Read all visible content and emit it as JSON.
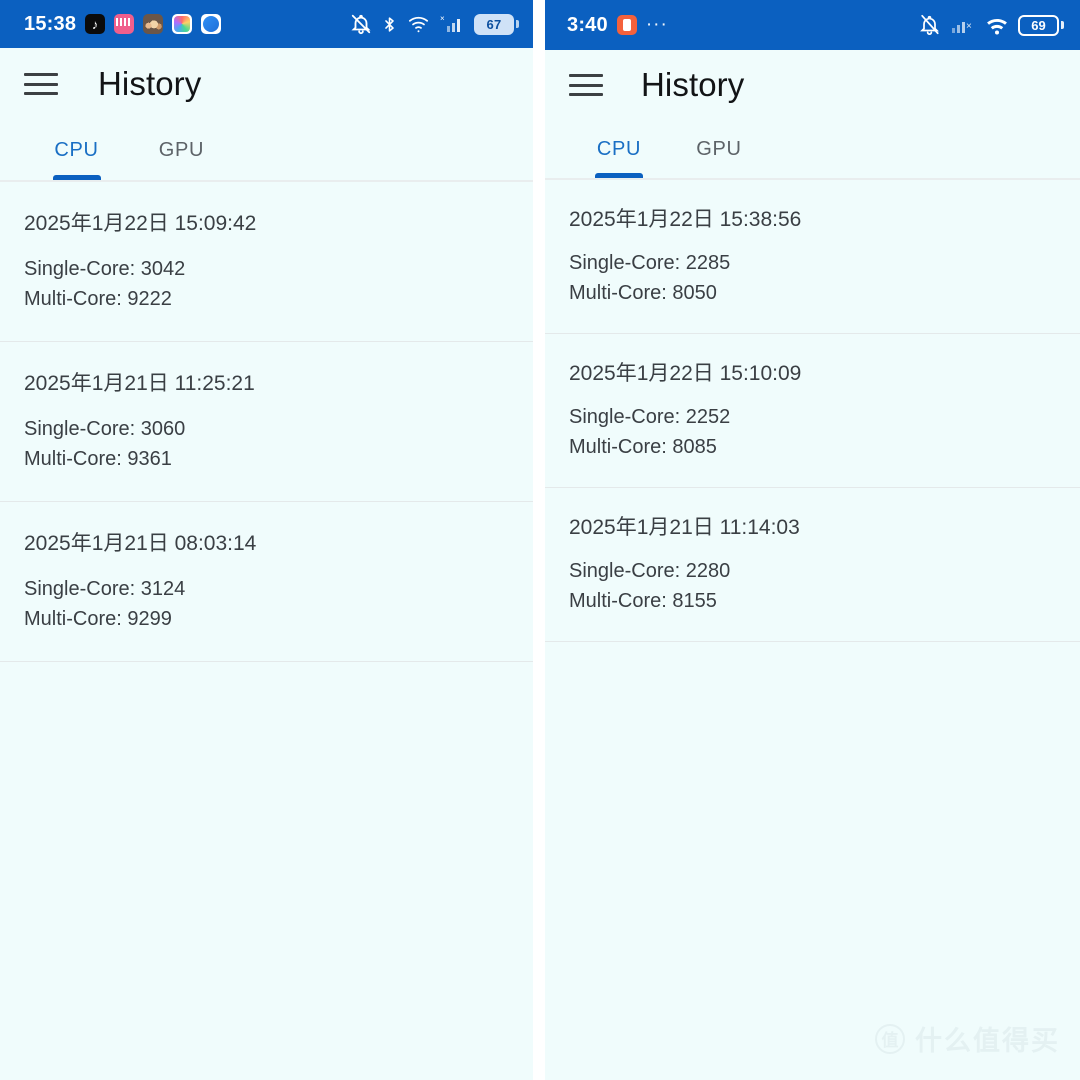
{
  "colors": {
    "status_bar_blue": "#0b60c0",
    "panel_background": "#f0fcfc",
    "accent_blue": "#0b60c0",
    "active_tab_text": "#1a6fc4",
    "inactive_tab_text": "#5d6368",
    "primary_text": "#3a3f44",
    "divider": "#e4e9ea"
  },
  "left_phone": {
    "status_bar": {
      "clock": "15:38",
      "notification_icons": [
        "tiktok-icon",
        "pink-app-icon",
        "photo-app-icon",
        "color-app-icon",
        "blue-app-icon"
      ],
      "system_icons": [
        "bell-off-icon",
        "bluetooth-icon",
        "wifi-icon",
        "cellular-signal-icon"
      ],
      "battery_percent": "67"
    },
    "app_bar": {
      "menu_icon": "hamburger-menu-icon",
      "title": "History"
    },
    "tabs": [
      {
        "label": "CPU",
        "active": true
      },
      {
        "label": "GPU",
        "active": false
      }
    ],
    "history": [
      {
        "date": "2025年1月22日 15:09:42",
        "single_core": "Single-Core: 3042",
        "multi_core": "Multi-Core: 9222"
      },
      {
        "date": "2025年1月21日 11:25:21",
        "single_core": "Single-Core: 3060",
        "multi_core": "Multi-Core: 9361"
      },
      {
        "date": "2025年1月21日 08:03:14",
        "single_core": "Single-Core: 3124",
        "multi_core": "Multi-Core: 9299"
      }
    ]
  },
  "right_phone": {
    "status_bar": {
      "clock": "3:40",
      "notification_icons": [
        "orange-app-icon",
        "more-dots-icon"
      ],
      "more_dots": "···",
      "system_icons": [
        "bell-off-icon",
        "cellular-signal-off-icon",
        "wifi-icon"
      ],
      "battery_percent": "69"
    },
    "app_bar": {
      "menu_icon": "hamburger-menu-icon",
      "title": "History"
    },
    "tabs": [
      {
        "label": "CPU",
        "active": true
      },
      {
        "label": "GPU",
        "active": false
      }
    ],
    "history": [
      {
        "date": "2025年1月22日 15:38:56",
        "single_core": "Single-Core: 2285",
        "multi_core": "Multi-Core: 8050"
      },
      {
        "date": "2025年1月22日 15:10:09",
        "single_core": "Single-Core: 2252",
        "multi_core": "Multi-Core: 8085"
      },
      {
        "date": "2025年1月21日 11:14:03",
        "single_core": "Single-Core: 2280",
        "multi_core": "Multi-Core: 8155"
      }
    ]
  },
  "watermark": {
    "badge": "值",
    "text": "什么值得买"
  }
}
